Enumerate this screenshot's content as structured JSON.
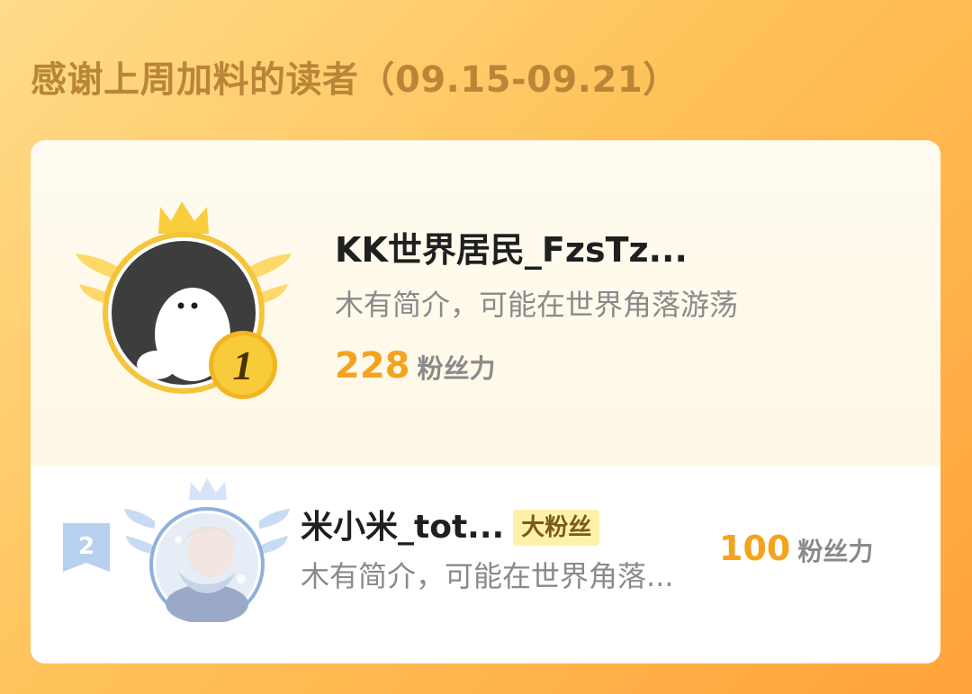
{
  "page": {
    "title": "感谢上周加料的读者（09.15-09.21）"
  },
  "colors": {
    "accent": "#f5a31e",
    "title": "#b98638",
    "gold": "#f5c22e",
    "silver_blue": "#a9c3e6"
  },
  "readers": [
    {
      "rank": "1",
      "name": "KK世界居民_FzsTz...",
      "bio": "木有简介，可能在世界角落游荡",
      "score": "228",
      "score_unit": "粉丝力",
      "badge_icon": "gold-crown-wing-badge"
    },
    {
      "rank": "2",
      "name": "米小米_tot...",
      "tag": "大粉丝",
      "bio": "木有简介，可能在世界角落...",
      "score": "100",
      "score_unit": "粉丝力",
      "badge_icon": "silver-crown-wing-badge"
    }
  ]
}
